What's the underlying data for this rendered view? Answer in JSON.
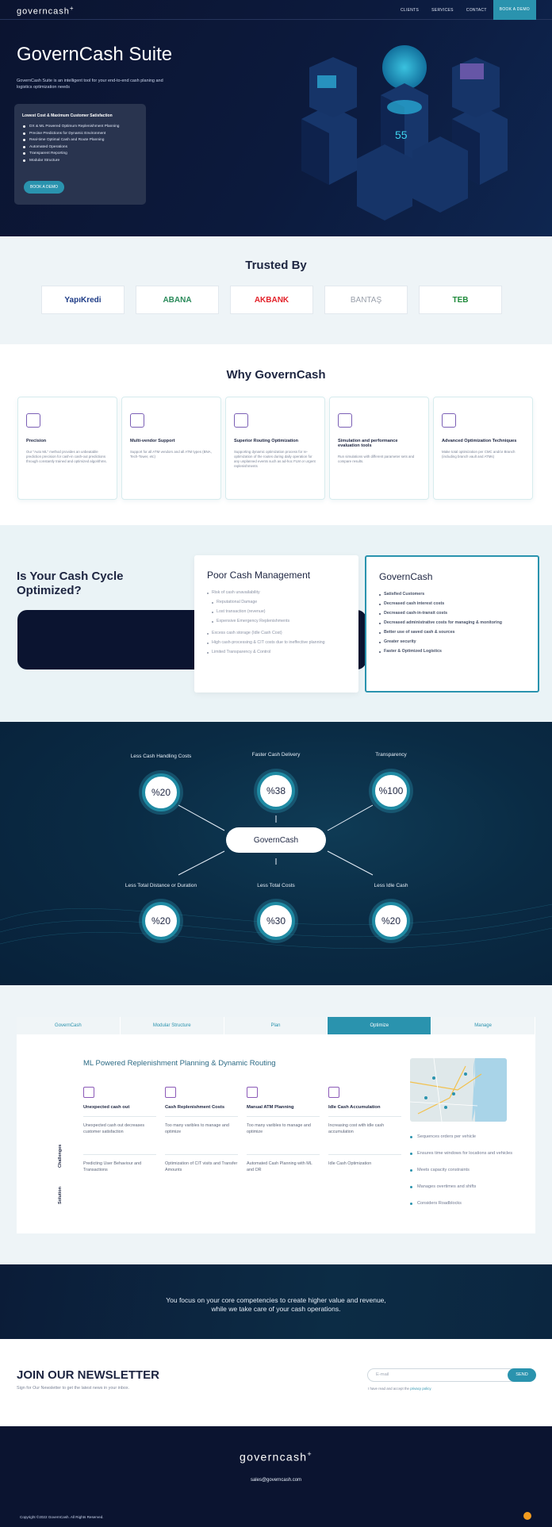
{
  "nav": {
    "logo": "governcash",
    "links": [
      "CLIENTS",
      "SERVICES",
      "CONTACT"
    ],
    "demo": "BOOK A DEMO"
  },
  "hero": {
    "title": "GovernCash Suite",
    "desc": "GovernCash Suite is an intelligent tool for your end-to-end cash planing and logistics optimization needs",
    "card_title": "Lowest Cost & Maximum Customer Satisfaction",
    "features": [
      "DX & ML Powered Optimum Replenishment Planning",
      "Precise Predictions for Dynamic Environment",
      "Real-time Optimal Cash and Route Planning",
      "Automated Operations",
      "Transparent Reporting",
      "Modular Structure"
    ],
    "cta": "BOOK A DEMO"
  },
  "trusted": {
    "title": "Trusted By",
    "logos": [
      "YapıKredi",
      "ABANA",
      "AKBANK",
      "BANTAŞ",
      "TEB"
    ]
  },
  "why": {
    "title": "Why GovernCash",
    "cards": [
      {
        "title": "Precision",
        "text": "Our \"Auto ML\" method provides an unbeatable prediction precision for cash-in cash-out predictions through constantly trained and optimized algorithms."
      },
      {
        "title": "Multi-vendor Support",
        "text": "Support for all ATM vendors and all ATM types (BNA, Tech-Tower, etc)"
      },
      {
        "title": "Superior Routing Optimization",
        "text": "Supporting dynamic optimization process for re-optimization of the routes during daily operation for any unplanned events such as ad-hoc FLM or urgent replenishments"
      },
      {
        "title": "Simulation and performance evaluation tools",
        "text": "Run simulations with different parameter sets and compare results."
      },
      {
        "title": "Advanced Optimization Techniques",
        "text": "Make total optimization per CMC and/or Branch (including branch vault and ATMs)"
      }
    ]
  },
  "cycle": {
    "title": "Is Your Cash Cycle Optimized?",
    "poor_title": "Poor Cash Management",
    "poor_items": [
      {
        "t": "Risk of cash unavailability",
        "sub": false
      },
      {
        "t": "Reputational Damage",
        "sub": true
      },
      {
        "t": "Lost transaction (revenue)",
        "sub": true
      },
      {
        "t": "Expensive Emergency Replenishments",
        "sub": true
      },
      {
        "t": "Excess cash storage (Idle Cash Cost)",
        "sub": false
      },
      {
        "t": "High cash-processing & CIT costs due to ineffective planning",
        "sub": false
      },
      {
        "t": "Limited Transparency & Control",
        "sub": false
      }
    ],
    "gc_title": "GovernCash",
    "gc_items": [
      "Satisfied Customers",
      "Decreased cash interest costs",
      "Decreased cash-in-transit costs",
      "Decreased administrative costs for managing & monitoring",
      "Better use of saved cash & sources",
      "Greater security",
      "Faster & Optimized Logistics"
    ]
  },
  "stats": {
    "center": "GovernCash",
    "top": [
      {
        "label": "Less Cash Handling Costs",
        "value": "%20"
      },
      {
        "label": "Faster Cash Delivery",
        "value": "%38"
      },
      {
        "label": "Transparency",
        "value": "%100"
      }
    ],
    "bottom": [
      {
        "label": "Less Total Distance or Duration",
        "value": "%20"
      },
      {
        "label": "Less Total Costs",
        "value": "%30"
      },
      {
        "label": "Less Idle Cash",
        "value": "%20"
      }
    ]
  },
  "tabs": {
    "labels": [
      "GovernCash",
      "Modular Structure",
      "Plan",
      "Optimize",
      "Manage"
    ],
    "active": 3,
    "title": "ML Powered Replenishment Planning & Dynamic Routing",
    "challenges_label": "Challenges",
    "solution_label": "Solution",
    "columns": [
      {
        "title": "Unexpected cash out",
        "challenge": "Unexpected cash out decreases customer satisfaction",
        "solution": "Predicting User Behaviour and Transactions"
      },
      {
        "title": "Cash Replenishment Costs",
        "challenge": "Too many varibles to manage and optimize",
        "solution": "Optimization of CIT visits and Transfer Amounts"
      },
      {
        "title": "Manual ATM Planning",
        "challenge": "Too many varibles to manage and optimize",
        "solution": "Automated Cash Planning with ML and OR"
      },
      {
        "title": "Idle Cash Accumulation",
        "challenge": "Increasing cost with idle cash accumulation",
        "solution": "Idle Cash Optimization"
      }
    ],
    "bullets": [
      "Sequences orders per vehicle",
      "Ensures time windows for locations and vehicles",
      "Meets capacity constraints",
      "Manages overtimes and shifts",
      "Considers Roadblocks"
    ]
  },
  "banner": {
    "line1": "You focus on your core competencies to create higher value and revenue,",
    "line2": "while we take care of your cash operations."
  },
  "newsletter": {
    "title": "JOIN OUR NEWSLETTER",
    "sub": "Sign for Our Newsletter to get the latest news in your inbox.",
    "placeholder": "E-mail",
    "send": "SEND",
    "privacy_pre": "I have read and accept the ",
    "privacy_link": "privacy policy"
  },
  "footer": {
    "logo": "governcash",
    "email": "sales@governcash.com",
    "copyright": "Copyright ©2022 GovernCash. All Rights Reserved."
  },
  "colors": {
    "accent": "#2a93ae",
    "navy": "#0b1430",
    "purple": "#7b5fb5"
  }
}
